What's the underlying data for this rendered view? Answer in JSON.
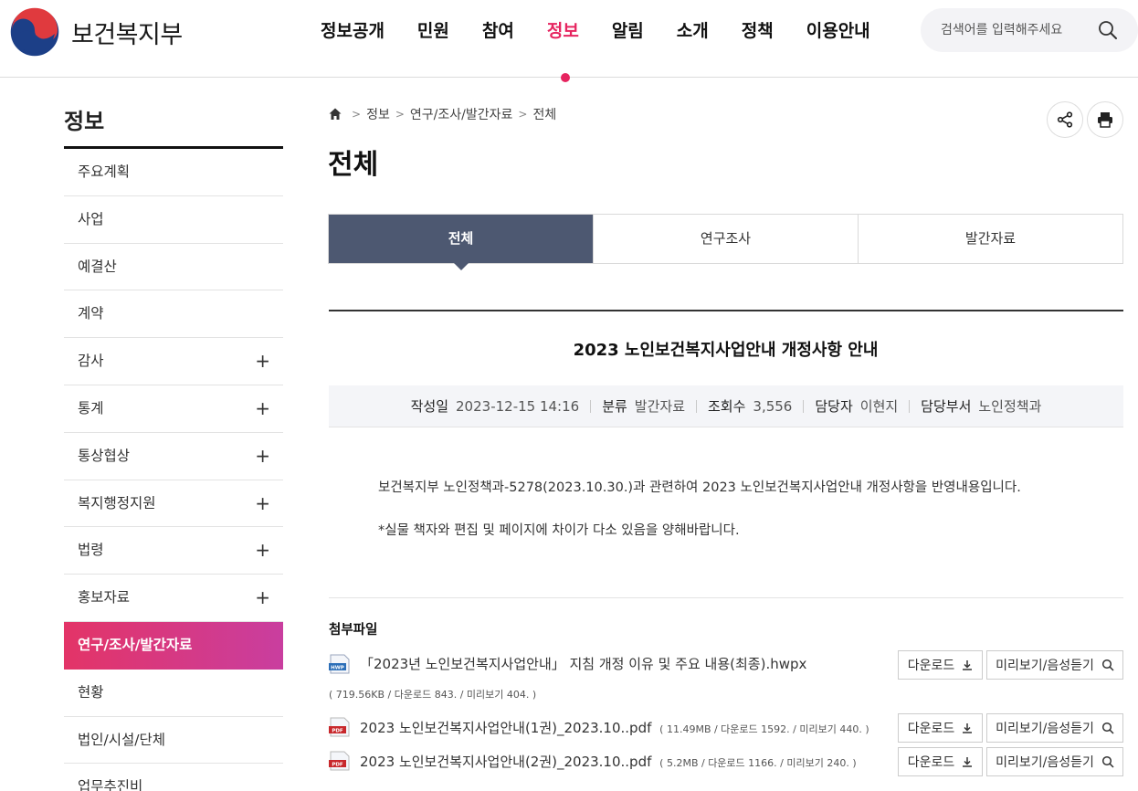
{
  "header": {
    "logo_text": "보건복지부",
    "nav": [
      "정보공개",
      "민원",
      "참여",
      "정보",
      "알림",
      "소개",
      "정책",
      "이용안내"
    ],
    "active_nav_index": 3,
    "search_placeholder": "검색어를 입력해주세요",
    "accent_color": "#e6245f"
  },
  "sidebar": {
    "title": "정보",
    "items": [
      {
        "label": "주요계획",
        "expand": ""
      },
      {
        "label": "사업",
        "expand": ""
      },
      {
        "label": "예결산",
        "expand": ""
      },
      {
        "label": "계약",
        "expand": ""
      },
      {
        "label": "감사",
        "expand": "+"
      },
      {
        "label": "통계",
        "expand": "+"
      },
      {
        "label": "통상협상",
        "expand": "+"
      },
      {
        "label": "복지행정지원",
        "expand": "+"
      },
      {
        "label": "법령",
        "expand": "+"
      },
      {
        "label": "홍보자료",
        "expand": "+"
      },
      {
        "label": "연구/조사/발간자료",
        "expand": ""
      },
      {
        "label": "현황",
        "expand": ""
      },
      {
        "label": "법인/시설/단체",
        "expand": ""
      },
      {
        "label": "업무추진비",
        "expand": ""
      }
    ],
    "active_index": 10
  },
  "breadcrumb": [
    "정보",
    "연구/조사/발간자료",
    "전체"
  ],
  "page_title": "전체",
  "tabs": [
    "전체",
    "연구조사",
    "발간자료"
  ],
  "active_tab_index": 0,
  "post": {
    "title": "2023 노인보건복지사업안내 개정사항 안내",
    "meta": {
      "date_label": "작성일",
      "date": "2023-12-15 14:16",
      "category_label": "분류",
      "category": "발간자료",
      "views_label": "조회수",
      "views": "3,556",
      "author_label": "담당자",
      "author": "이현지",
      "dept_label": "담당부서",
      "dept": "노인정책과"
    },
    "body": [
      "보건복지부 노인정책과-5278(2023.10.30.)과 관련하여 2023 노인보건복지사업안내 개정사항을 반영내용입니다.",
      "*실물 책자와 편집 및 페이지에 차이가 다소 있음을 양해바랍니다."
    ]
  },
  "attachments": {
    "title": "첨부파일",
    "download_label": "다운로드",
    "preview_label": "미리보기/음성듣기",
    "files": [
      {
        "type": "HWP",
        "name": "「2023년 노인보건복지사업안내」 지침 개정 이유 및 주요 내용(최종).hwpx",
        "meta": "( 719.56KB / 다운로드 843. / 미리보기 404. )"
      },
      {
        "type": "PDF",
        "name": "2023 노인보건복지사업안내(1권)_2023.10..pdf",
        "meta": "( 11.49MB / 다운로드 1592. / 미리보기 440. )"
      },
      {
        "type": "PDF",
        "name": "2023 노인보건복지사업안내(2권)_2023.10..pdf",
        "meta": "( 5.2MB / 다운로드 1166. / 미리보기 240. )"
      }
    ]
  }
}
